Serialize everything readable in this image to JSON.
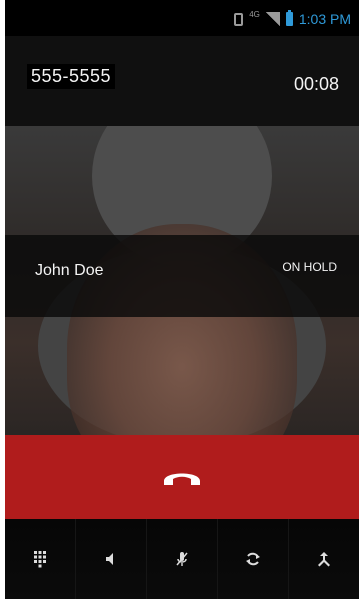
{
  "status_bar": {
    "network": "4G",
    "time": "1:03 PM"
  },
  "call": {
    "number": "555-5555",
    "duration": "00:08",
    "caller_name": "John Doe",
    "state": "ON HOLD"
  },
  "colors": {
    "end_call": "#b01c1c",
    "status_accent": "#2f9ad9"
  },
  "controls": [
    {
      "icon": "dialpad-icon"
    },
    {
      "icon": "speaker-icon"
    },
    {
      "icon": "mute-mic-icon"
    },
    {
      "icon": "swap-calls-icon"
    },
    {
      "icon": "merge-calls-icon"
    }
  ]
}
